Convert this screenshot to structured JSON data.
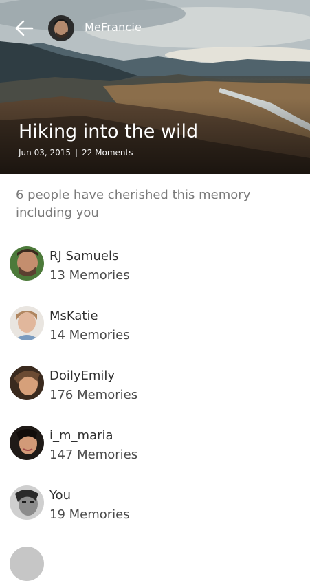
{
  "header": {
    "owner_name": "MeFrancie",
    "title": "Hiking into the wild",
    "date": "Jun 03, 2015",
    "separator": "|",
    "moments": "22 Moments"
  },
  "summary": "6 people have cherished this memory including you",
  "people": [
    {
      "name": "RJ Samuels",
      "count": "13 Memories"
    },
    {
      "name": "MsKatie",
      "count": "14 Memories"
    },
    {
      "name": "DoilyEmily",
      "count": "176 Memories"
    },
    {
      "name": "i_m_maria",
      "count": "147 Memories"
    },
    {
      "name": "You",
      "count": "19 Memories"
    }
  ],
  "icons": {
    "back": "back-arrow-icon"
  },
  "colors": {
    "summary_text": "#7a7a7a",
    "name_text": "#2f2f2f"
  }
}
